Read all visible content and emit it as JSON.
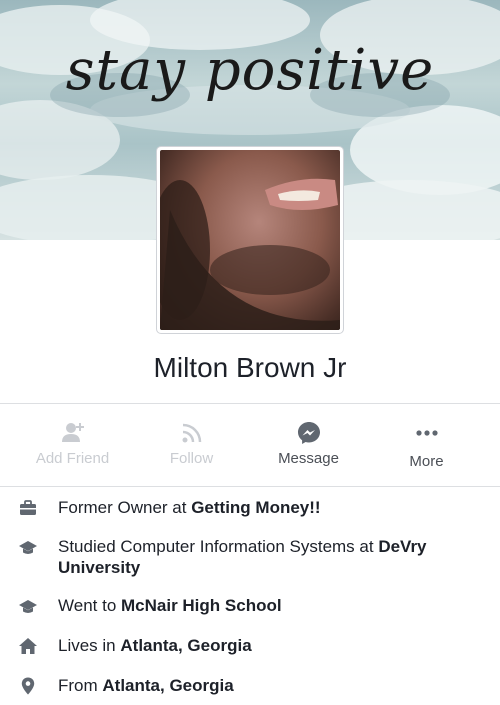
{
  "cover": {
    "caption": "stay positive"
  },
  "profile": {
    "name": "Milton Brown Jr"
  },
  "actions": [
    {
      "label": "Add Friend",
      "icon": "add-friend-icon",
      "enabled": false
    },
    {
      "label": "Follow",
      "icon": "rss-follow-icon",
      "enabled": false
    },
    {
      "label": "Message",
      "icon": "messenger-icon",
      "enabled": true
    },
    {
      "label": "More",
      "icon": "more-dots-icon",
      "enabled": true
    }
  ],
  "intro": [
    {
      "icon": "briefcase-icon",
      "prefix": "Former Owner at ",
      "bold": "Getting Money!!"
    },
    {
      "icon": "graduation-cap-icon",
      "prefix": "Studied Computer Information Systems at ",
      "bold": "DeVry University"
    },
    {
      "icon": "graduation-cap-icon",
      "prefix": "Went to ",
      "bold": "McNair High School"
    },
    {
      "icon": "house-icon",
      "prefix": "Lives in ",
      "bold": "Atlanta, Georgia"
    },
    {
      "icon": "location-pin-icon",
      "prefix": "From ",
      "bold": "Atlanta, Georgia"
    }
  ],
  "colors": {
    "disabled": "#c9ccd1",
    "enabled": "#4b4f56",
    "icon": "#606770",
    "divider": "#dddfe2"
  }
}
